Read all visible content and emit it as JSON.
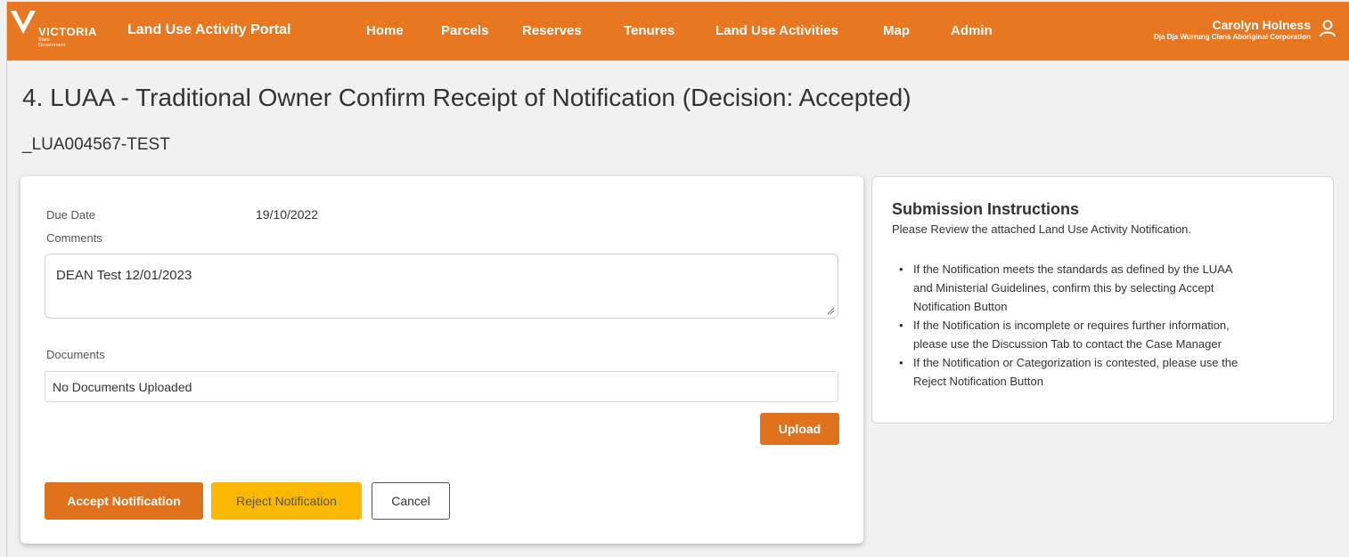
{
  "header": {
    "logo_word": "VICTORIA",
    "logo_sub": "State Government",
    "brand": "Land Use Activity Portal",
    "nav": [
      {
        "label": "Home"
      },
      {
        "label": "Parcels"
      },
      {
        "label": "Reserves"
      },
      {
        "label": "Tenures"
      },
      {
        "label": "Land Use Activities"
      },
      {
        "label": "Map"
      },
      {
        "label": "Admin"
      }
    ],
    "user": {
      "name": "Carolyn Holness",
      "org": "Dja Dja Wurrung Clans Aboriginal Corporation",
      "icon": "user-icon"
    },
    "colors": {
      "bar": "#e87722"
    }
  },
  "page": {
    "title": "4. LUAA - Traditional Owner Confirm Receipt of Notification (Decision: Accepted)",
    "case_id": "_LUA004567-TEST"
  },
  "form": {
    "due_date_label": "Due Date",
    "due_date_value": "19/10/2022",
    "comments_label": "Comments",
    "comments_value": "DEAN Test 12/01/2023",
    "documents_label": "Documents",
    "documents_value": "No Documents Uploaded",
    "upload_label": "Upload",
    "accept_label": "Accept Notification",
    "reject_label": "Reject Notification",
    "cancel_label": "Cancel",
    "colors": {
      "primary": "#e0721d",
      "warning": "#fbb800"
    }
  },
  "instructions": {
    "title": "Submission Instructions",
    "intro": "Please Review the attached Land Use Activity Notification.",
    "items": [
      {
        "line1": "If the Notification meets the standards as defined by the LUAA",
        "line2": "and Ministerial Guidelines, confirm this by selecting Accept",
        "line3": "Notification Button"
      },
      {
        "line1": "If the Notification is incomplete or requires further information,",
        "line2": "please use the Discussion Tab to contact the Case Manager"
      },
      {
        "line1": "If the Notification or Categorization is contested, please use the",
        "line2": "Reject Notification Button"
      }
    ]
  }
}
